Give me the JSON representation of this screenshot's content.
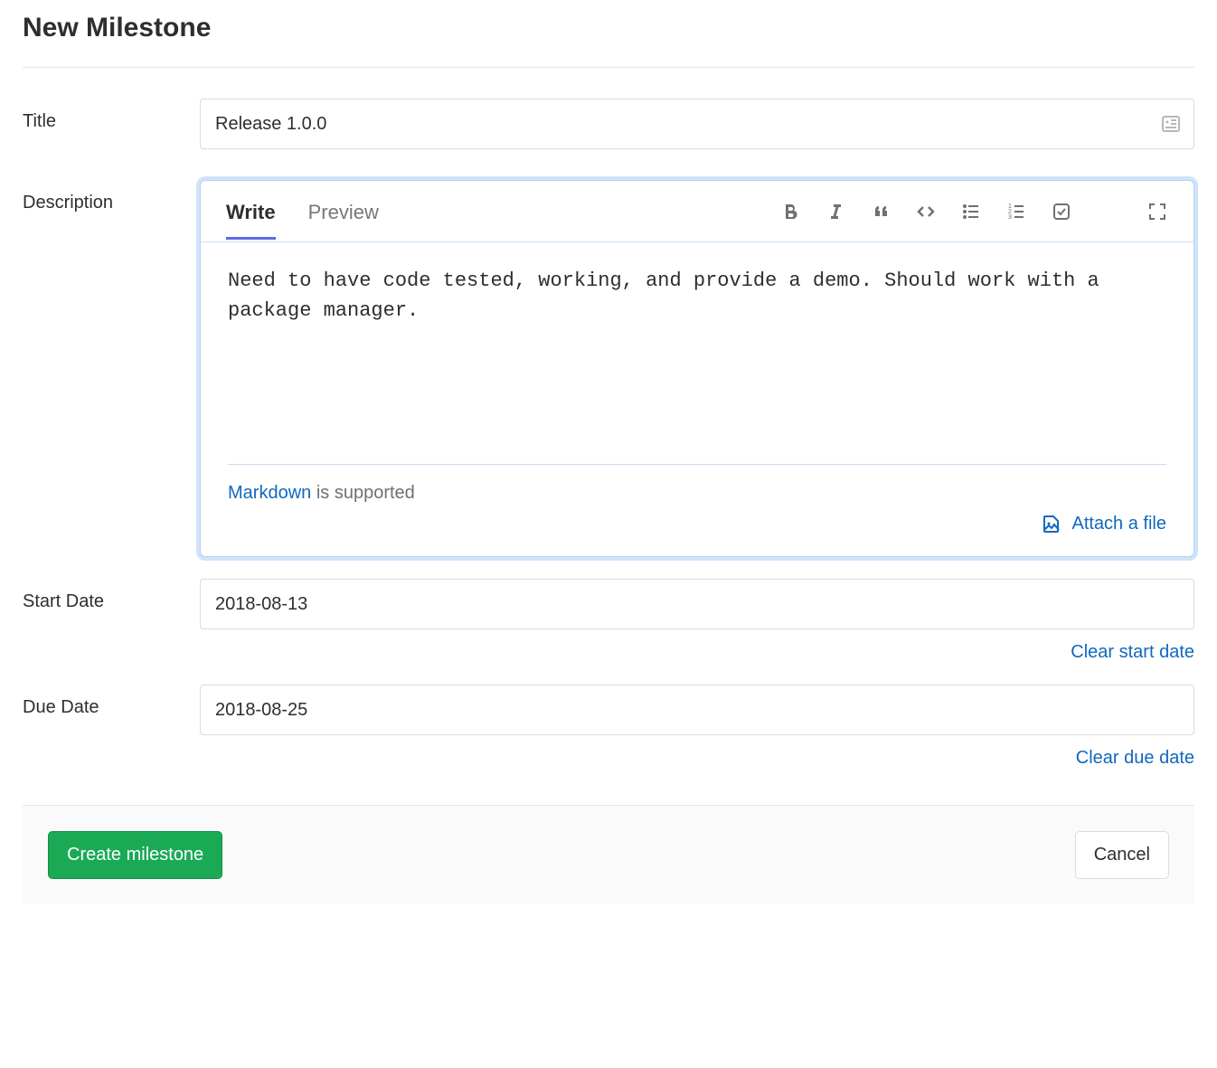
{
  "page": {
    "title": "New Milestone"
  },
  "form": {
    "title": {
      "label": "Title",
      "value": "Release 1.0.0"
    },
    "description": {
      "label": "Description",
      "tabs": {
        "write": "Write",
        "preview": "Preview"
      },
      "value": "Need to have code tested, working, and provide a demo. Should work with a package manager.",
      "markdown_link": "Markdown",
      "markdown_suffix": " is supported",
      "attach_label": "Attach a file"
    },
    "start_date": {
      "label": "Start Date",
      "value": "2018-08-13",
      "clear_label": "Clear start date"
    },
    "due_date": {
      "label": "Due Date",
      "value": "2018-08-25",
      "clear_label": "Clear due date"
    }
  },
  "actions": {
    "submit": "Create milestone",
    "cancel": "Cancel"
  }
}
